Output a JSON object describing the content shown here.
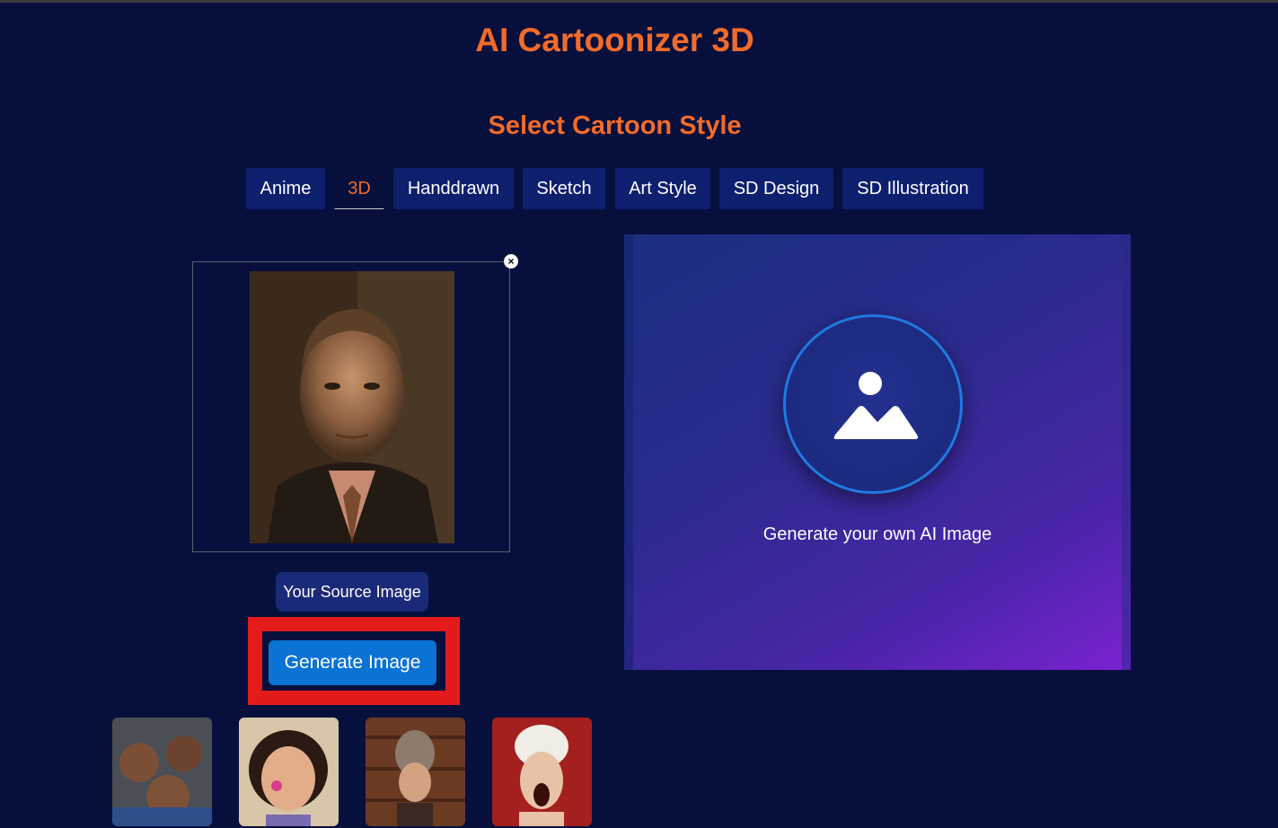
{
  "header": {
    "title": "AI Cartoonizer 3D",
    "style_heading": "Select Cartoon Style"
  },
  "styles": {
    "tabs": [
      {
        "label": "Anime"
      },
      {
        "label": "3D"
      },
      {
        "label": "Handdrawn"
      },
      {
        "label": "Sketch"
      },
      {
        "label": "Art Style"
      },
      {
        "label": "SD Design"
      },
      {
        "label": "SD Illustration"
      }
    ],
    "active": "3D"
  },
  "source": {
    "close_symbol": "×",
    "label": "Your Source Image"
  },
  "actions": {
    "generate_label": "Generate Image"
  },
  "output": {
    "placeholder_text": "Generate your own AI Image",
    "icon": "image-placeholder-icon"
  },
  "samples": {
    "count_visible": 4,
    "icons": [
      "sample-kids",
      "sample-girl",
      "sample-hat-man",
      "sample-screaming-woman"
    ]
  },
  "colors": {
    "background": "#07103d",
    "accent_orange": "#f26b2a",
    "tab_bg": "#0e1f6e",
    "button_blue": "#0a73d4",
    "highlight_red": "#e31b1b"
  }
}
